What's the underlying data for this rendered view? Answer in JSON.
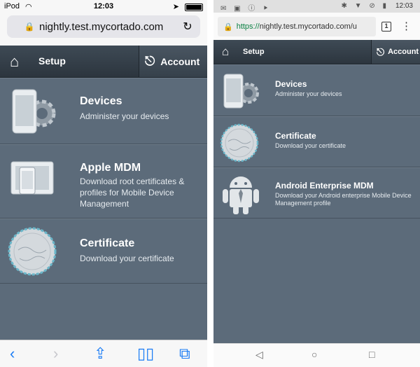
{
  "ios": {
    "status": {
      "carrier": "iPod",
      "time": "12:03"
    },
    "url": "nightly.test.mycortado.com",
    "topbar": {
      "setup": "Setup",
      "account": "Account"
    },
    "items": [
      {
        "title": "Devices",
        "desc": "Administer your devices",
        "icon": "devices-icon"
      },
      {
        "title": "Apple MDM",
        "desc": "Download root certificates & profiles for Mobile Device Management",
        "icon": "apple-mdm-icon"
      },
      {
        "title": "Certificate",
        "desc": "Download your certificate",
        "icon": "certificate-icon"
      }
    ]
  },
  "android": {
    "status": {
      "time": "12:03"
    },
    "url": {
      "https": "https://",
      "rest": "nightly.test.mycortado.com/u"
    },
    "tab_count": "1",
    "topbar": {
      "setup": "Setup",
      "account": "Account"
    },
    "items": [
      {
        "title": "Devices",
        "desc": "Administer your devices",
        "icon": "devices-icon"
      },
      {
        "title": "Certificate",
        "desc": "Download your certificate",
        "icon": "certificate-icon"
      },
      {
        "title": "Android Enterprise MDM",
        "desc": "Download your Android enterprise Mobile Device Management profile",
        "icon": "android-icon"
      }
    ]
  },
  "colors": {
    "app_bg": "#5c6b7a",
    "topbar": "#2c353e",
    "accent_ios": "#1a7cf5",
    "https_green": "#0b8043"
  }
}
